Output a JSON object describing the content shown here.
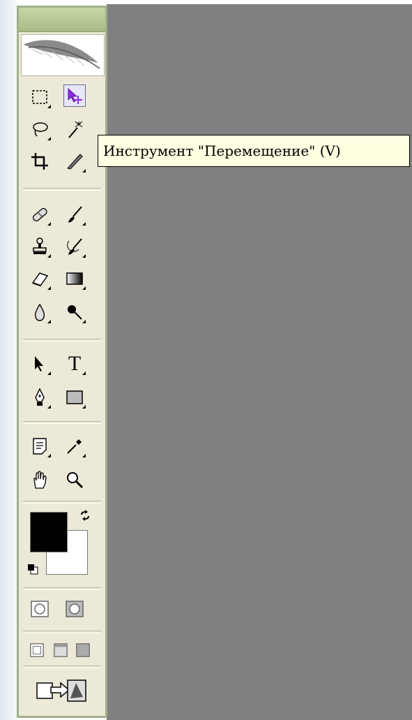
{
  "tooltip": {
    "text": "Инструмент \"Перемещение\" (V)"
  },
  "toolbox": {
    "tools": [
      {
        "name": "rectangular-marquee-icon"
      },
      {
        "name": "move-tool-icon",
        "active": true
      },
      {
        "name": "lasso-icon"
      },
      {
        "name": "magic-wand-icon"
      },
      {
        "name": "crop-icon"
      },
      {
        "name": "slice-icon"
      },
      {
        "name": "healing-brush-icon"
      },
      {
        "name": "brush-icon"
      },
      {
        "name": "clone-stamp-icon"
      },
      {
        "name": "history-brush-icon"
      },
      {
        "name": "eraser-icon"
      },
      {
        "name": "gradient-icon"
      },
      {
        "name": "blur-icon"
      },
      {
        "name": "dodge-icon"
      },
      {
        "name": "path-selection-icon"
      },
      {
        "name": "type-icon",
        "label": "T"
      },
      {
        "name": "pen-icon"
      },
      {
        "name": "rectangle-shape-icon"
      },
      {
        "name": "notes-icon"
      },
      {
        "name": "eyedropper-icon"
      },
      {
        "name": "hand-icon"
      },
      {
        "name": "zoom-icon"
      }
    ],
    "foreground_color": "#000000",
    "background_color": "#ffffff",
    "accent_active": "#8a2be2",
    "canvas_color": "#808080"
  }
}
